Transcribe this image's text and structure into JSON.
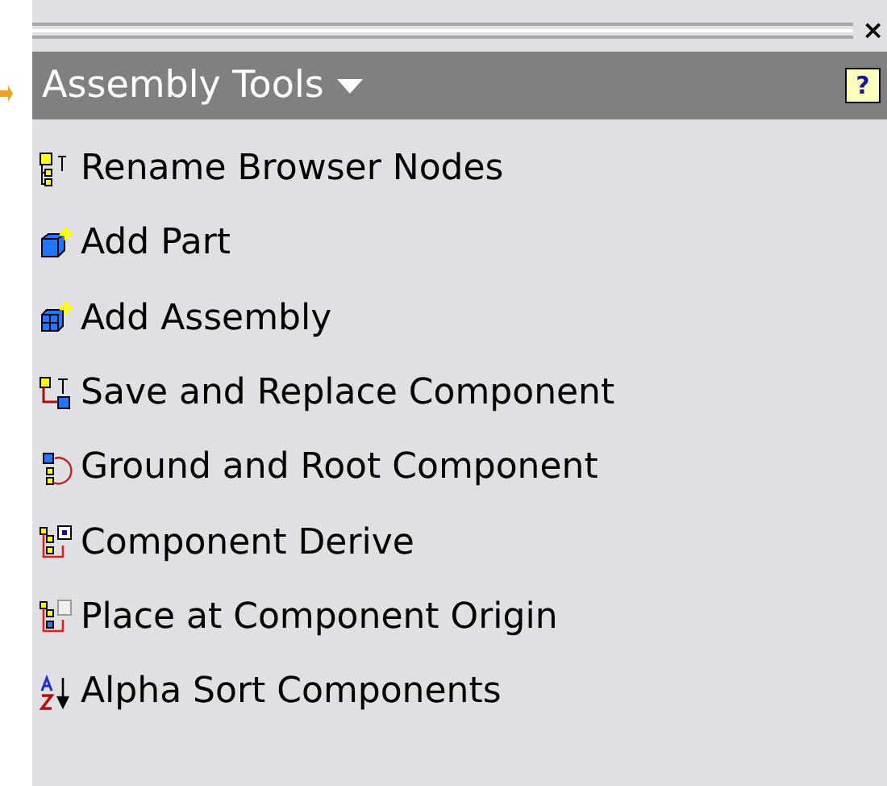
{
  "panel": {
    "close": "×",
    "title": "Assembly Tools",
    "help": "?"
  },
  "items": [
    {
      "kind": "rename",
      "label": "Rename Browser Nodes"
    },
    {
      "kind": "part",
      "label": "Add Part"
    },
    {
      "kind": "assembly",
      "label": "Add Assembly"
    },
    {
      "kind": "replace",
      "label": "Save and Replace Component"
    },
    {
      "kind": "ground",
      "label": "Ground and Root Component"
    },
    {
      "kind": "derive",
      "label": "Component Derive"
    },
    {
      "kind": "origin",
      "label": "Place at Component Origin"
    },
    {
      "kind": "sort",
      "label": "Alpha Sort Components"
    }
  ]
}
